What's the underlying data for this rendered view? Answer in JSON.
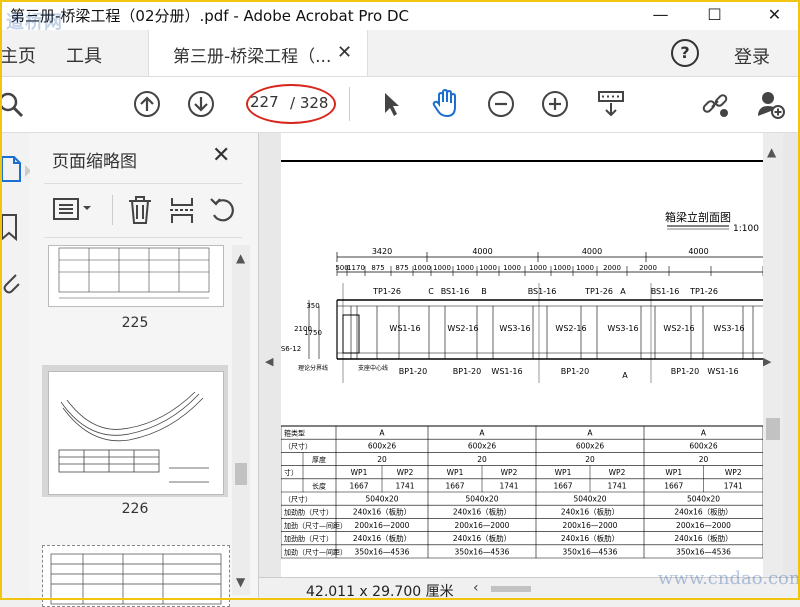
{
  "window": {
    "title": "第三册-桥梁工程（02分册）.pdf - Adobe Acrobat Pro DC",
    "minimize": "—",
    "maximize": "☐",
    "close": "✕"
  },
  "tabs": {
    "home": "主页",
    "tools": "工具",
    "document": "第三册-桥梁工程（...",
    "document_close": "✕",
    "help": "?",
    "login": "登录"
  },
  "toolbar": {
    "current_page": "227",
    "total_pages": "/ 328",
    "icons": [
      "search-icon",
      "page-up-icon",
      "page-down-icon",
      "select-arrow-icon",
      "hand-icon",
      "zoom-out-icon",
      "zoom-in-icon",
      "scroll-mode-icon",
      "link-icon",
      "add-user-icon"
    ]
  },
  "thumbnail_panel": {
    "title": "页面缩略图",
    "close": "✕",
    "thumbs": [
      {
        "label": "225"
      },
      {
        "label": "226"
      }
    ]
  },
  "drawing": {
    "title": "箱梁立剖面图",
    "scale": "1:100",
    "top_dims": [
      "3420",
      "4000",
      "4000",
      "4000"
    ],
    "sub_dims": [
      "500",
      "1170",
      "875",
      "875",
      "1000",
      "1000",
      "1000",
      "1000",
      "1000",
      "1000",
      "1000",
      "1000",
      "2000",
      "2000"
    ],
    "section_marks": [
      "TP1-26",
      "C",
      "BS1-16",
      "B",
      "BS1-16",
      "TP1-26",
      "A",
      "BS1-16",
      "TP1-26"
    ],
    "ws_labels": [
      "WS1-16",
      "WS2-16",
      "WS3-16",
      "WS2-16",
      "WS3-16",
      "WS2-16",
      "WS3-16"
    ],
    "bottom_marks": [
      "BP1-20",
      "BP1-20",
      "WS1-16",
      "BP1-20",
      "A",
      "BP1-20",
      "WS1-16",
      "A"
    ],
    "left_dims": [
      "2100",
      "1750",
      "350",
      "S6-12"
    ],
    "notes": [
      "理论分界线",
      "支座中心线"
    ],
    "table": {
      "col_headers": [
        "A",
        "A",
        "A",
        "A"
      ],
      "rows": [
        {
          "label": "箍类型",
          "sub": "",
          "cells": [
            "A",
            "A",
            "A",
            "A"
          ]
        },
        {
          "label": "（尺寸）",
          "sub": "",
          "cells": [
            "600x26",
            "600x26",
            "600x26",
            "600x26"
          ]
        },
        {
          "label": "",
          "sub": "厚度",
          "cells": [
            "20",
            "20",
            "20",
            "20"
          ]
        },
        {
          "label": "寸）",
          "sub": "",
          "cells": [
            "WP1",
            "WP2",
            "WP1",
            "WP2",
            "WP1",
            "WP2",
            "WP1",
            "WP2"
          ]
        },
        {
          "label": "",
          "sub": "长度",
          "cells": [
            "1667",
            "1741",
            "1667",
            "1741",
            "1667",
            "1741",
            "1667",
            "1741"
          ]
        },
        {
          "label": "（尺寸）",
          "sub": "",
          "cells": [
            "5040x20",
            "5040x20",
            "5040x20",
            "5040x20"
          ]
        },
        {
          "label": "加劲肋（尺寸）",
          "sub": "",
          "cells": [
            "240x16（板肋）",
            "240x16（板肋）",
            "240x16（板肋）",
            "240x16（板肋）"
          ]
        },
        {
          "label": "加劲（尺寸—间距）",
          "sub": "",
          "cells": [
            "200x16—2000",
            "200x16—2000",
            "200x16—2000",
            "200x16—2000"
          ]
        },
        {
          "label": "加劲肋（尺寸）",
          "sub": "",
          "cells": [
            "240x16（板肋）",
            "240x16（板肋）",
            "240x16（板肋）",
            "240x16（板肋）"
          ]
        },
        {
          "label": "加劲（尺寸—间距）",
          "sub": "",
          "cells": [
            "350x16—4536",
            "350x16—4536",
            "350x16—4536",
            "350x16—4536"
          ]
        }
      ]
    }
  },
  "statusbar": {
    "page_size": "42.011 x 29.700 厘米"
  },
  "watermarks": {
    "top_left": "道桥网",
    "bottom_right": "www.cndao.com"
  },
  "colors": {
    "accent_blue": "#1a6fd1",
    "annotation_red": "#d8251c",
    "frame_yellow": "#f1c40f"
  }
}
